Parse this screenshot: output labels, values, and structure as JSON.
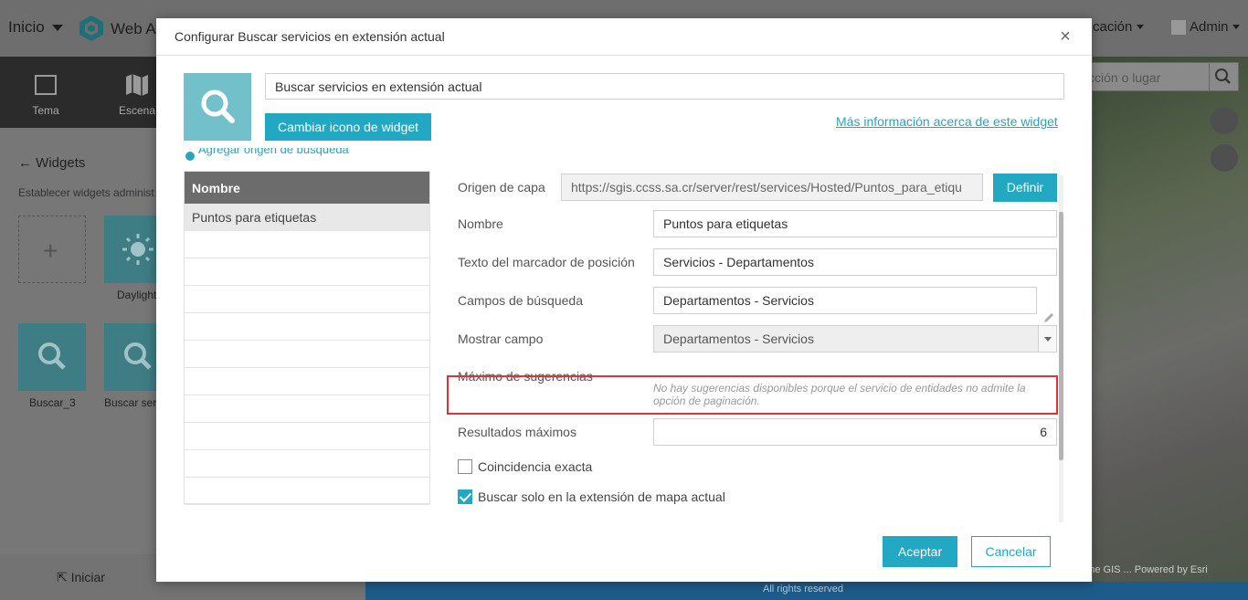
{
  "app": {
    "inicio_label": "Inicio",
    "app_name": "Web A",
    "right_menu_label": "cación",
    "admin_label": "Admin",
    "tabs": [
      {
        "label": "Tema"
      },
      {
        "label": "Escena"
      }
    ],
    "widgets_title": "Widgets",
    "widgets_subtitle": "Establecer widgets administ",
    "widget_tiles": [
      {
        "label": "Daylight"
      },
      {
        "label": "Buscar_3"
      },
      {
        "label": "Buscar ser"
      }
    ],
    "iniciar_label": "Iniciar",
    "map_search_placeholder": "cción o lugar",
    "rights_text": "All rights reserved",
    "attribution": "d the GIS ... Powered by Esri"
  },
  "dialog": {
    "title": "Configurar Buscar servicios en extensión actual",
    "widget_name": "Buscar servicios en extensión actual",
    "change_icon_label": "Cambiar icono de widget",
    "more_info_link": "Más información acerca de este widget",
    "add_source_label": "Agregar origen de búsqueda",
    "sources_header": "Nombre",
    "sources": [
      "Puntos para etiquetas",
      "",
      "",
      "",
      "",
      "",
      "",
      "",
      "",
      "",
      ""
    ],
    "form": {
      "layer_source_label": "Origen de capa",
      "layer_source_value": "https://sgis.ccss.sa.cr/server/rest/services/Hosted/Puntos_para_etiqu",
      "define_label": "Definir",
      "name_label": "Nombre",
      "name_value": "Puntos para etiquetas",
      "placeholder_label": "Texto del marcador de posición",
      "placeholder_value": "Servicios - Departamentos",
      "search_fields_label": "Campos de búsqueda",
      "search_fields_value": "Departamentos - Servicios",
      "display_field_label": "Mostrar campo",
      "display_field_value": "Departamentos - Servicios",
      "max_suggestions_label": "Máximo de sugerencias",
      "max_suggestions_note": "No hay sugerencias disponibles porque el servicio de entidades no admite la opción de paginación.",
      "max_results_label": "Resultados máximos",
      "max_results_value": "6",
      "exact_match_label": "Coincidencia exacta",
      "exact_match_checked": false,
      "extent_only_label": "Buscar solo en la extensión de mapa actual",
      "extent_only_checked": true
    },
    "ok_label": "Aceptar",
    "cancel_label": "Cancelar"
  },
  "colors": {
    "accent": "#22a8c2",
    "highlight": "#e0303a",
    "icon_bg": "#72c0c9"
  }
}
